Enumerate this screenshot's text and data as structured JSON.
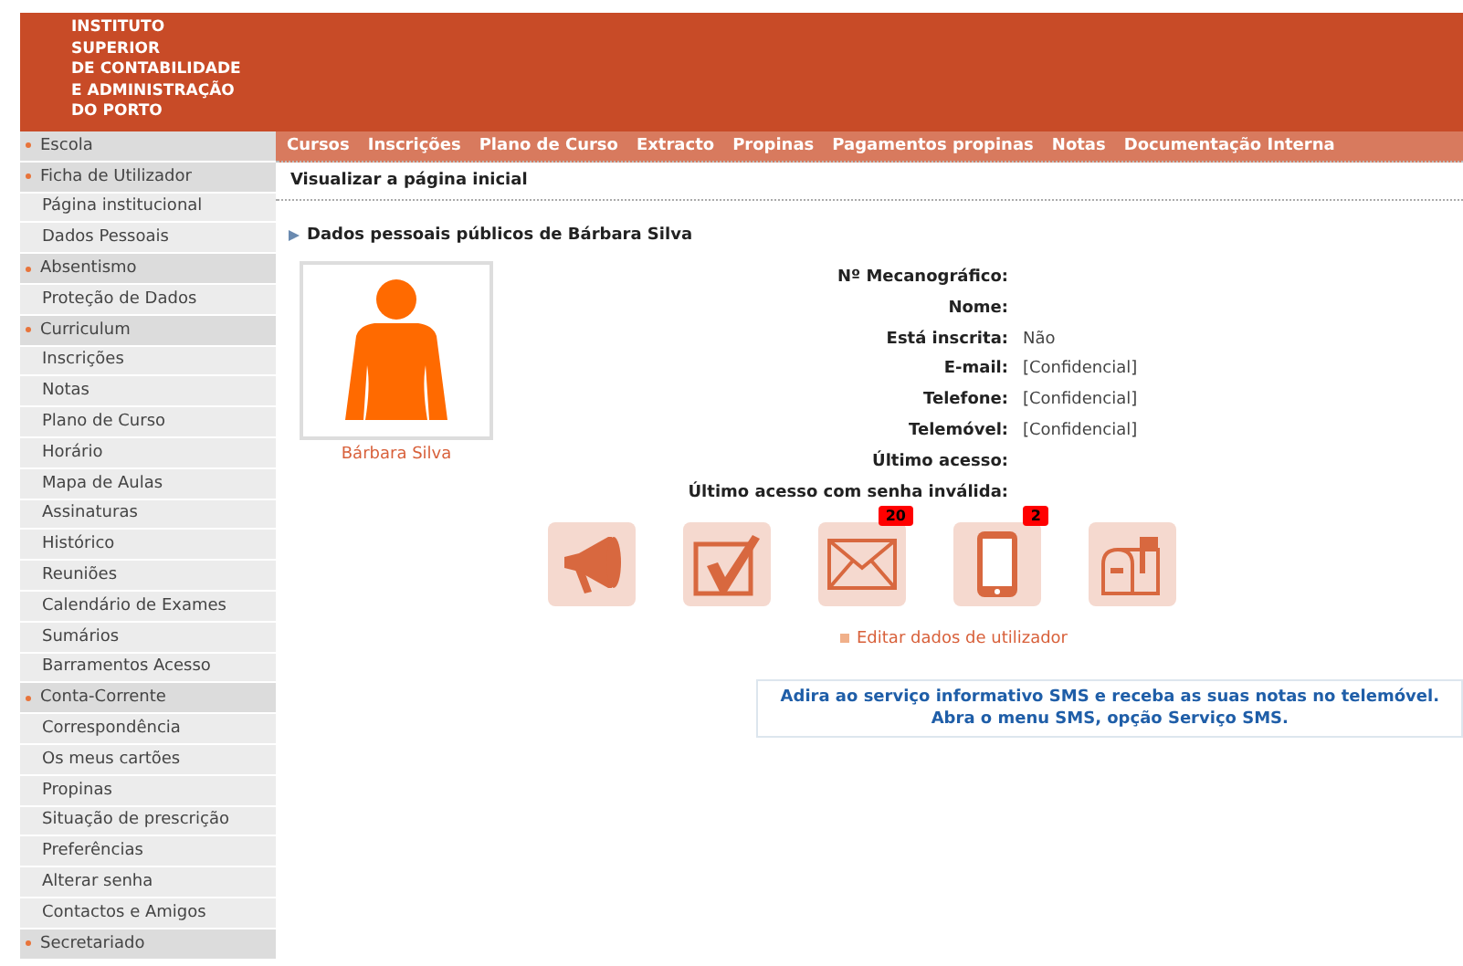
{
  "header": {
    "logo_lines": [
      "INSTITUTO",
      "SUPERIOR",
      "DE CONTABILIDADE",
      "E ADMINISTRAÇÃO",
      "DO PORTO"
    ]
  },
  "sidebar": {
    "items": [
      {
        "label": "Escola",
        "kind": "section"
      },
      {
        "label": "Ficha de Utilizador",
        "kind": "section"
      },
      {
        "label": "Página institucional",
        "kind": "item"
      },
      {
        "label": "Dados Pessoais",
        "kind": "item"
      },
      {
        "label": "Absentismo",
        "kind": "section"
      },
      {
        "label": "Proteção de Dados",
        "kind": "item"
      },
      {
        "label": "Curriculum",
        "kind": "section"
      },
      {
        "label": "Inscrições",
        "kind": "item"
      },
      {
        "label": "Notas",
        "kind": "item"
      },
      {
        "label": "Plano de Curso",
        "kind": "item"
      },
      {
        "label": "Horário",
        "kind": "item"
      },
      {
        "label": "Mapa de Aulas",
        "kind": "item"
      },
      {
        "label": "Assinaturas",
        "kind": "item"
      },
      {
        "label": "Histórico",
        "kind": "item"
      },
      {
        "label": "Reuniões",
        "kind": "item"
      },
      {
        "label": "Calendário de Exames",
        "kind": "item"
      },
      {
        "label": "Sumários",
        "kind": "item"
      },
      {
        "label": "Barramentos Acesso",
        "kind": "item"
      },
      {
        "label": "Conta-Corrente",
        "kind": "section"
      },
      {
        "label": "Correspondência",
        "kind": "item"
      },
      {
        "label": "Os meus cartões",
        "kind": "item"
      },
      {
        "label": "Propinas",
        "kind": "item"
      },
      {
        "label": "Situação de prescrição",
        "kind": "item"
      },
      {
        "label": "Preferências",
        "kind": "item"
      },
      {
        "label": "Alterar senha",
        "kind": "item"
      },
      {
        "label": "Contactos e Amigos",
        "kind": "item"
      },
      {
        "label": "Secretariado",
        "kind": "section"
      }
    ]
  },
  "nav": [
    "Cursos",
    "Inscrições",
    "Plano de Curso",
    "Extracto",
    "Propinas",
    "Pagamentos propinas",
    "Notas",
    "Documentação Interna"
  ],
  "breadcrumb": "Visualizar a página inicial",
  "section_title": "Dados pessoais públicos de Bárbara Silva",
  "profile": {
    "name": "Bárbara Silva"
  },
  "fields": [
    {
      "label": "Nº Mecanográfico:"
    },
    {
      "label": "Nome:"
    },
    {
      "label": "Está inscrita:",
      "value": "Não"
    },
    {
      "label": "E-mail:",
      "value": "[Confidencial]"
    },
    {
      "label": "Telefone:",
      "value": "[Confidencial]"
    },
    {
      "label": "Telemóvel:",
      "value": "[Confidencial]"
    },
    {
      "label": "Último acesso:"
    },
    {
      "label": "Último acesso com senha inválida:"
    }
  ],
  "tiles": [
    {
      "kind": "megaphone"
    },
    {
      "kind": "check"
    },
    {
      "kind": "mail",
      "badge": "20"
    },
    {
      "kind": "phone",
      "badge": "2"
    },
    {
      "kind": "mailbox"
    }
  ],
  "edit_link": "Editar dados de utilizador",
  "sms_notice": [
    "Adira ao serviço informativo SMS e receba as suas notas no telemóvel.",
    "Abra o menu SMS, opção Serviço SMS."
  ]
}
